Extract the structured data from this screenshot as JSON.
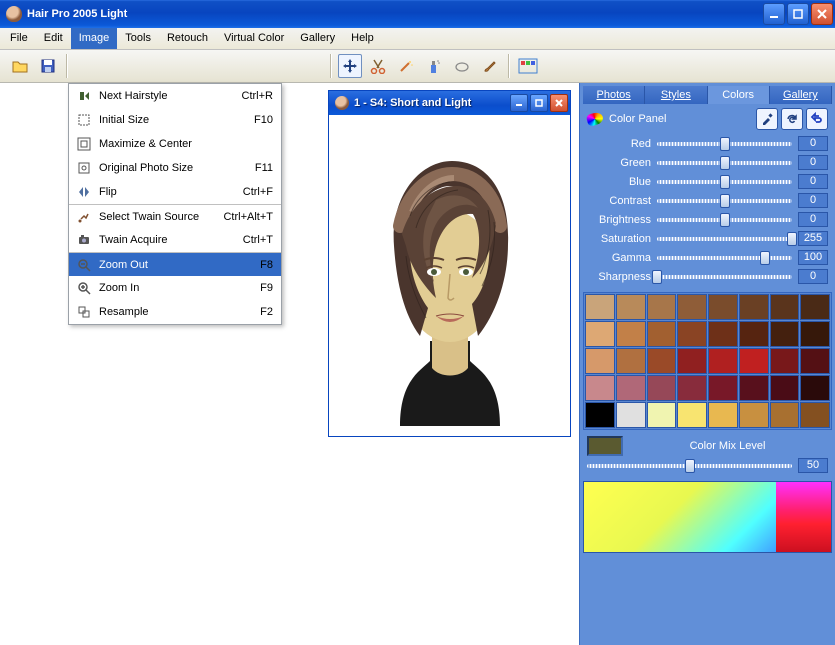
{
  "app": {
    "title": "Hair Pro 2005  Light"
  },
  "menu": {
    "file": "File",
    "edit": "Edit",
    "image": "Image",
    "tools": "Tools",
    "retouch": "Retouch",
    "vcolor": "Virtual Color",
    "gallery": "Gallery",
    "help": "Help"
  },
  "image_menu": [
    {
      "icon": "next",
      "label": "Next Hairstyle",
      "shortcut": "Ctrl+R",
      "sep": false,
      "sel": false
    },
    {
      "icon": "size",
      "label": "Initial Size",
      "shortcut": "F10",
      "sep": false,
      "sel": false
    },
    {
      "icon": "max",
      "label": "Maximize & Center",
      "shortcut": "",
      "sep": false,
      "sel": false
    },
    {
      "icon": "orig",
      "label": "Original Photo Size",
      "shortcut": "F11",
      "sep": false,
      "sel": false
    },
    {
      "icon": "flip",
      "label": "Flip",
      "shortcut": "Ctrl+F",
      "sep": false,
      "sel": false
    },
    {
      "icon": "twsrc",
      "label": "Select Twain Source",
      "shortcut": "Ctrl+Alt+T",
      "sep": true,
      "sel": false
    },
    {
      "icon": "twacq",
      "label": "Twain Acquire",
      "shortcut": "Ctrl+T",
      "sep": false,
      "sel": false
    },
    {
      "icon": "zout",
      "label": "Zoom Out",
      "shortcut": "F8",
      "sep": true,
      "sel": true
    },
    {
      "icon": "zin",
      "label": "Zoom In",
      "shortcut": "F9",
      "sep": false,
      "sel": false
    },
    {
      "icon": "resam",
      "label": "Resample",
      "shortcut": "F2",
      "sep": false,
      "sel": false
    }
  ],
  "inner": {
    "title": "1 - S4: Short and Light"
  },
  "tabs": {
    "photos": "Photos",
    "styles": "Styles",
    "colors": "Colors",
    "gallery": "Gallery",
    "active": "colors"
  },
  "panel": {
    "title": "Color Panel",
    "sliders": [
      {
        "name": "Red",
        "value": "0",
        "pct": 50
      },
      {
        "name": "Green",
        "value": "0",
        "pct": 50
      },
      {
        "name": "Blue",
        "value": "0",
        "pct": 50
      },
      {
        "name": "Contrast",
        "value": "0",
        "pct": 50
      },
      {
        "name": "Brightness",
        "value": "0",
        "pct": 50
      },
      {
        "name": "Saturation",
        "value": "255",
        "pct": 100
      },
      {
        "name": "Gamma",
        "value": "100",
        "pct": 80
      },
      {
        "name": "Sharpness",
        "value": "0",
        "pct": 0
      }
    ],
    "mix_label": "Color Mix Level",
    "mix_value": "50",
    "mix_pct": 50,
    "swatch_current": "#5a5a30",
    "palette": [
      "#c9a47a",
      "#b88a5a",
      "#a7764a",
      "#8f5d38",
      "#7a4c2c",
      "#6a4024",
      "#5a341c",
      "#4a2a16",
      "#dda874",
      "#c28048",
      "#a26030",
      "#8a4424",
      "#6e3018",
      "#562410",
      "#44200e",
      "#36180a",
      "#d6996a",
      "#b07040",
      "#9a4a28",
      "#902020",
      "#b02020",
      "#c02020",
      "#78181a",
      "#541014",
      "#c8888c",
      "#b06878",
      "#964858",
      "#882c3c",
      "#781828",
      "#58101c",
      "#4a0c16",
      "#2a0a0a",
      "#000000",
      "#e0e0e0",
      "#f0f4b0",
      "#f8e470",
      "#e8b850",
      "#c89040",
      "#a87030",
      "#845020"
    ]
  }
}
